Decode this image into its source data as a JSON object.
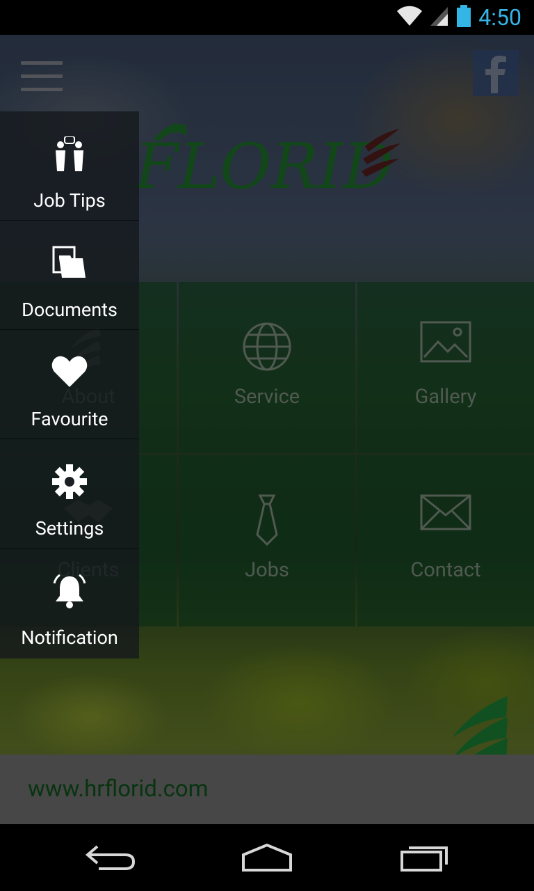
{
  "status_bar": {
    "time": "4:50",
    "icons": [
      "wifi-icon",
      "signal-icon",
      "battery-icon"
    ]
  },
  "header": {
    "menu_icon": "hamburger-icon",
    "social_icon": "facebook-icon",
    "logo_text": "FLORID"
  },
  "grid": {
    "tiles": [
      {
        "label": "About",
        "icon": "leaves-icon"
      },
      {
        "label": "Service",
        "icon": "globe-icon"
      },
      {
        "label": "Gallery",
        "icon": "image-icon"
      },
      {
        "label": "Clients",
        "icon": "handshake-icon"
      },
      {
        "label": "Jobs",
        "icon": "tie-icon"
      },
      {
        "label": "Contact",
        "icon": "envelope-icon"
      }
    ]
  },
  "footer": {
    "url": "www.hrflorid.com"
  },
  "drawer": {
    "items": [
      {
        "label": "Job Tips",
        "icon": "people-chat-icon"
      },
      {
        "label": "Documents",
        "icon": "documents-icon"
      },
      {
        "label": "Favourite",
        "icon": "heart-icon"
      },
      {
        "label": "Settings",
        "icon": "gear-icon"
      },
      {
        "label": "Notification",
        "icon": "bell-icon"
      }
    ]
  },
  "nav_bar": {
    "buttons": [
      "back-icon",
      "home-icon",
      "recents-icon"
    ]
  },
  "colors": {
    "accent": "#33b5e5",
    "brand_green": "#1a6b28",
    "tile_bg": "#165028",
    "footer_text": "#0e5a1c"
  }
}
